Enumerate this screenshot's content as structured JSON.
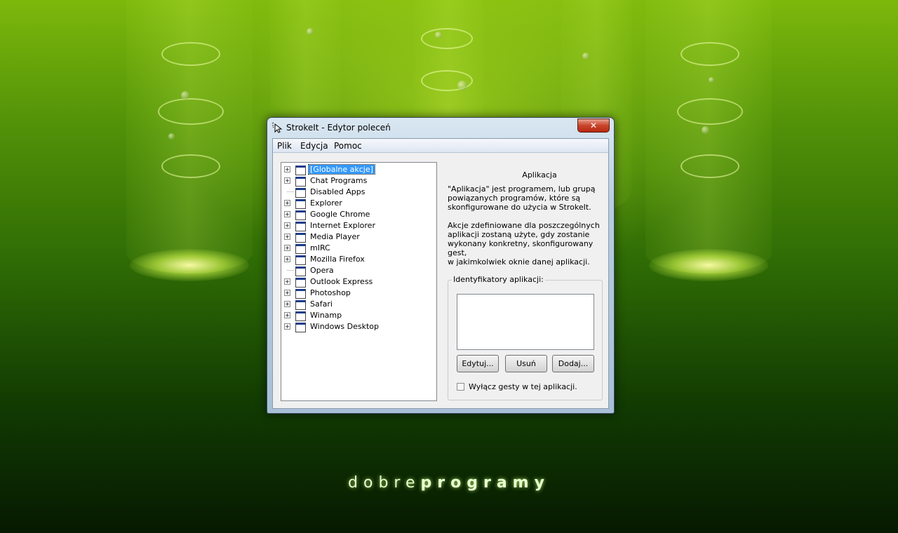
{
  "window": {
    "title": "StrokeIt - Edytor poleceń",
    "close_label": "✕"
  },
  "menu": [
    "Plik",
    "Edycja",
    "Pomoc"
  ],
  "tree": [
    {
      "label": "[Globalne akcje]",
      "expandable": true,
      "selected": true
    },
    {
      "label": "Chat Programs",
      "expandable": true
    },
    {
      "label": "Disabled Apps",
      "expandable": false
    },
    {
      "label": "Explorer",
      "expandable": true
    },
    {
      "label": "Google Chrome",
      "expandable": true
    },
    {
      "label": "Internet Explorer",
      "expandable": true
    },
    {
      "label": "Media Player",
      "expandable": true
    },
    {
      "label": "mIRC",
      "expandable": true
    },
    {
      "label": "Mozilla Firefox",
      "expandable": true
    },
    {
      "label": "Opera",
      "expandable": false
    },
    {
      "label": "Outlook Express",
      "expandable": true
    },
    {
      "label": "Photoshop",
      "expandable": true
    },
    {
      "label": "Safari",
      "expandable": true
    },
    {
      "label": "Winamp",
      "expandable": true
    },
    {
      "label": "Windows Desktop",
      "expandable": true
    }
  ],
  "panel": {
    "heading": "Aplikacja",
    "paragraph1": [
      "\"Aplikacja\" jest programem, lub grupą",
      "powiązanych programów, które są",
      "skonfigurowane do użycia w StrokeIt."
    ],
    "paragraph2": [
      "Akcje zdefiniowane dla poszczególnych",
      "aplikacji zostaną użyte, gdy zostanie",
      "wykonany konkretny, skonfigurowany gest,",
      "w jakimkolwiek oknie danej aplikacji."
    ],
    "group_label": "Identyfikatory aplikacji:",
    "buttons": {
      "edit": "Edytuj...",
      "remove": "Usuń",
      "add": "Dodaj..."
    },
    "checkbox_label": "Wyłącz gesty w tej aplikacji.",
    "checkbox_checked": false
  },
  "brand": {
    "light": "dobre",
    "bold": "programy"
  }
}
